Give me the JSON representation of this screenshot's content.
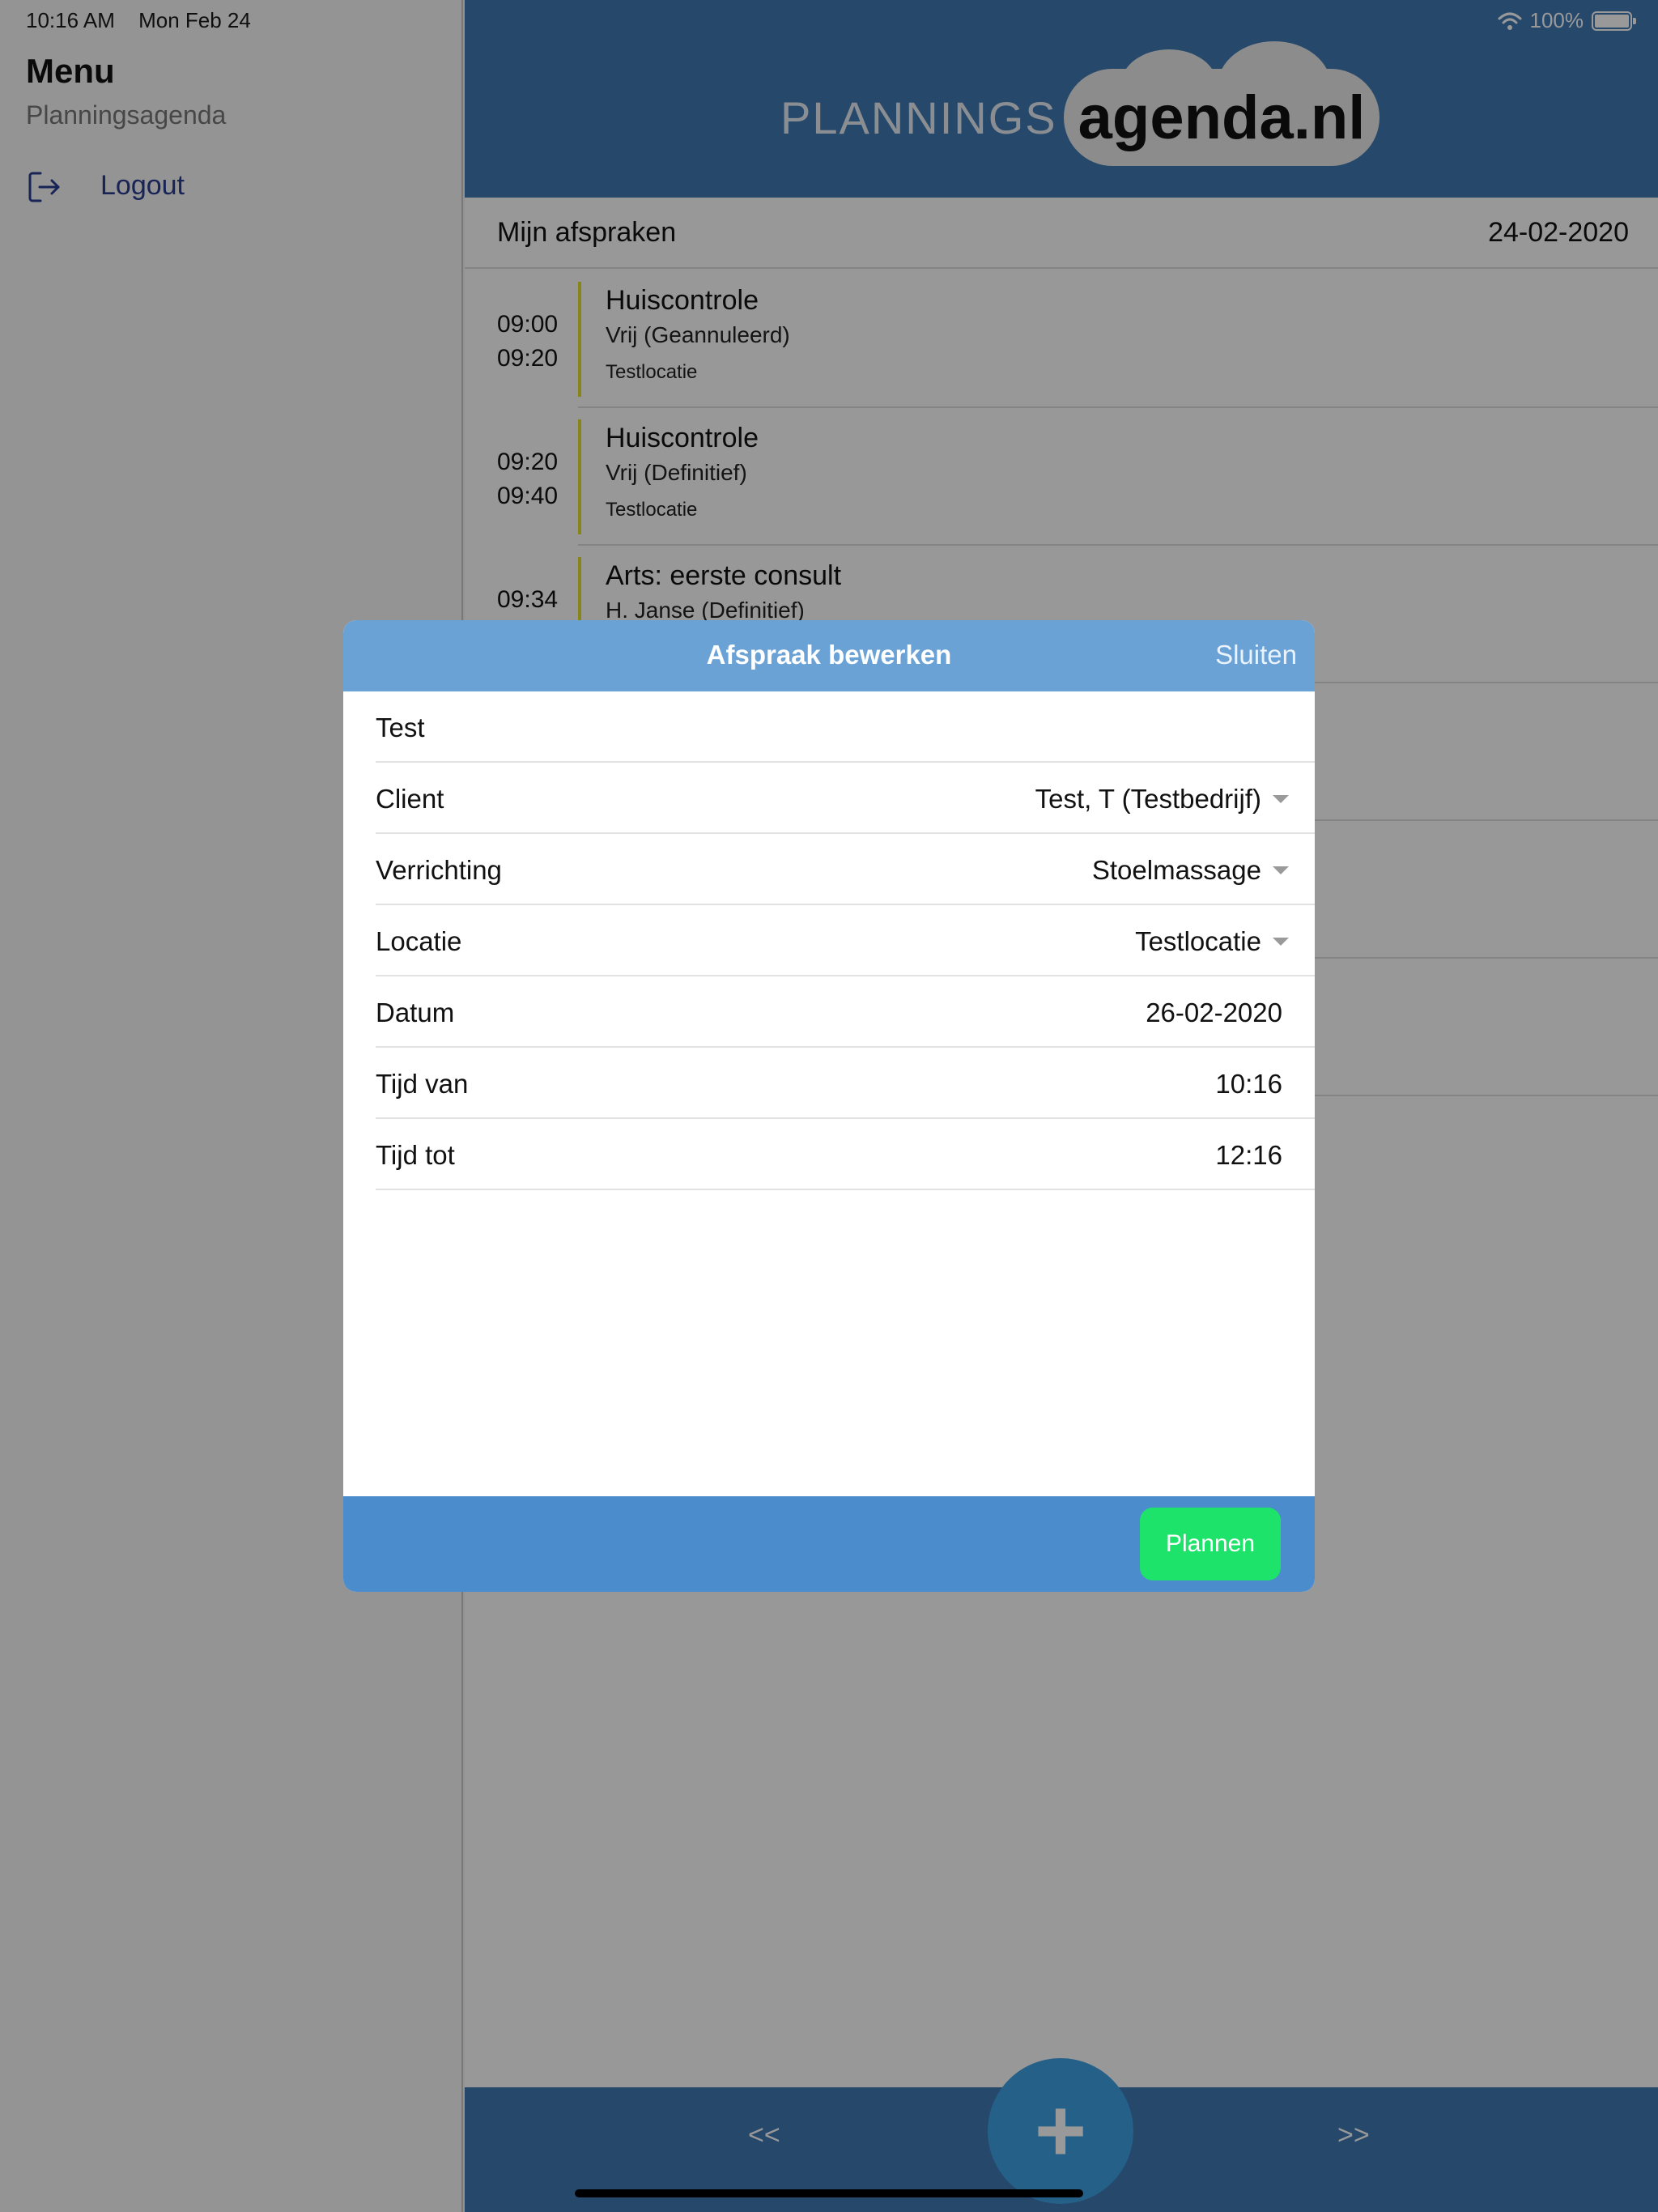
{
  "status_bar": {
    "time": "10:16 AM",
    "date": "Mon Feb 24",
    "battery": "100%",
    "battery_level": 1.0
  },
  "sidebar": {
    "title": "Menu",
    "subtitle": "Planningsagenda",
    "items": [
      {
        "label": "Logout",
        "icon": "logout-icon"
      }
    ]
  },
  "header": {
    "logo_left": "PLANNINGS",
    "logo_right": "agenda.nl"
  },
  "list": {
    "title": "Mijn afspraken",
    "date": "24-02-2020",
    "appointments": [
      {
        "start": "09:00",
        "end": "09:20",
        "title": "Huiscontrole",
        "subtitle": "Vrij (Geannuleerd)",
        "location": "Testlocatie"
      },
      {
        "start": "09:20",
        "end": "09:40",
        "title": "Huiscontrole",
        "subtitle": "Vrij (Definitief)",
        "location": "Testlocatie"
      },
      {
        "start": "09:34",
        "end": "",
        "title": "Arts: eerste consult",
        "subtitle": "H. Janse (Definitief)",
        "location": ""
      }
    ]
  },
  "footer": {
    "prev_label": "<<",
    "next_label": ">>",
    "add_label": "+"
  },
  "modal": {
    "title": "Afspraak bewerken",
    "close_label": "Sluiten",
    "name_value": "Test",
    "fields": [
      {
        "label": "Client",
        "value": "Test, T (Testbedrijf)",
        "dropdown": true
      },
      {
        "label": "Verrichting",
        "value": "Stoelmassage",
        "dropdown": true
      },
      {
        "label": "Locatie",
        "value": "Testlocatie",
        "dropdown": true
      },
      {
        "label": "Datum",
        "value": "26-02-2020",
        "dropdown": false
      },
      {
        "label": "Tijd van",
        "value": "10:16",
        "dropdown": false
      },
      {
        "label": "Tijd tot",
        "value": "12:16",
        "dropdown": false
      }
    ],
    "submit_label": "Plannen"
  },
  "colors": {
    "header_blue": "#3e78b3",
    "modal_header": "#6aa2d6",
    "modal_footer": "#4a8ccc",
    "submit_green": "#1ee36a",
    "appointment_bar": "#e2e22a",
    "link_blue": "#2a3c8f"
  }
}
